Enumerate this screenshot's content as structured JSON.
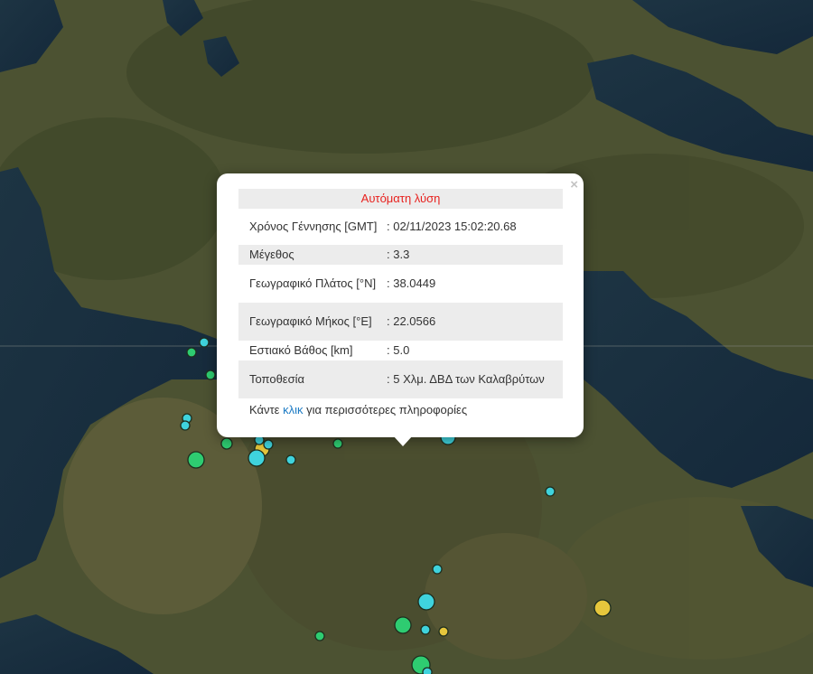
{
  "popup": {
    "header": "Αυτόματη λύση",
    "close_symbol": "×",
    "rows": [
      {
        "label": "Χρόνος Γέννησης [GMT]",
        "value": ": 02/11/2023 15:02:20.68"
      },
      {
        "label": "Μέγεθος",
        "value": ": 3.3"
      },
      {
        "label": "Γεωγραφικό Πλάτος [°N]",
        "value": ": 38.0449"
      },
      {
        "label": "Γεωγραφικό Μήκος [°E]",
        "value": ": 22.0566"
      },
      {
        "label": "Εστιακό Βάθος [km]",
        "value": ": 5.0"
      },
      {
        "label": "Τοποθεσία",
        "value": ": 5 Χλμ. ΔΒΔ των Καλαβρύτων"
      }
    ],
    "more_prefix": "Κάντε",
    "more_link": "κλικ",
    "more_suffix": "για περισσότερες πληροφορίες"
  },
  "colors": {
    "header_text": "#e8221f",
    "link": "#1d7bc4",
    "marker_green": "#2ecc71",
    "marker_cyan": "#3fd3dd",
    "marker_yellow": "#e6c63c"
  }
}
